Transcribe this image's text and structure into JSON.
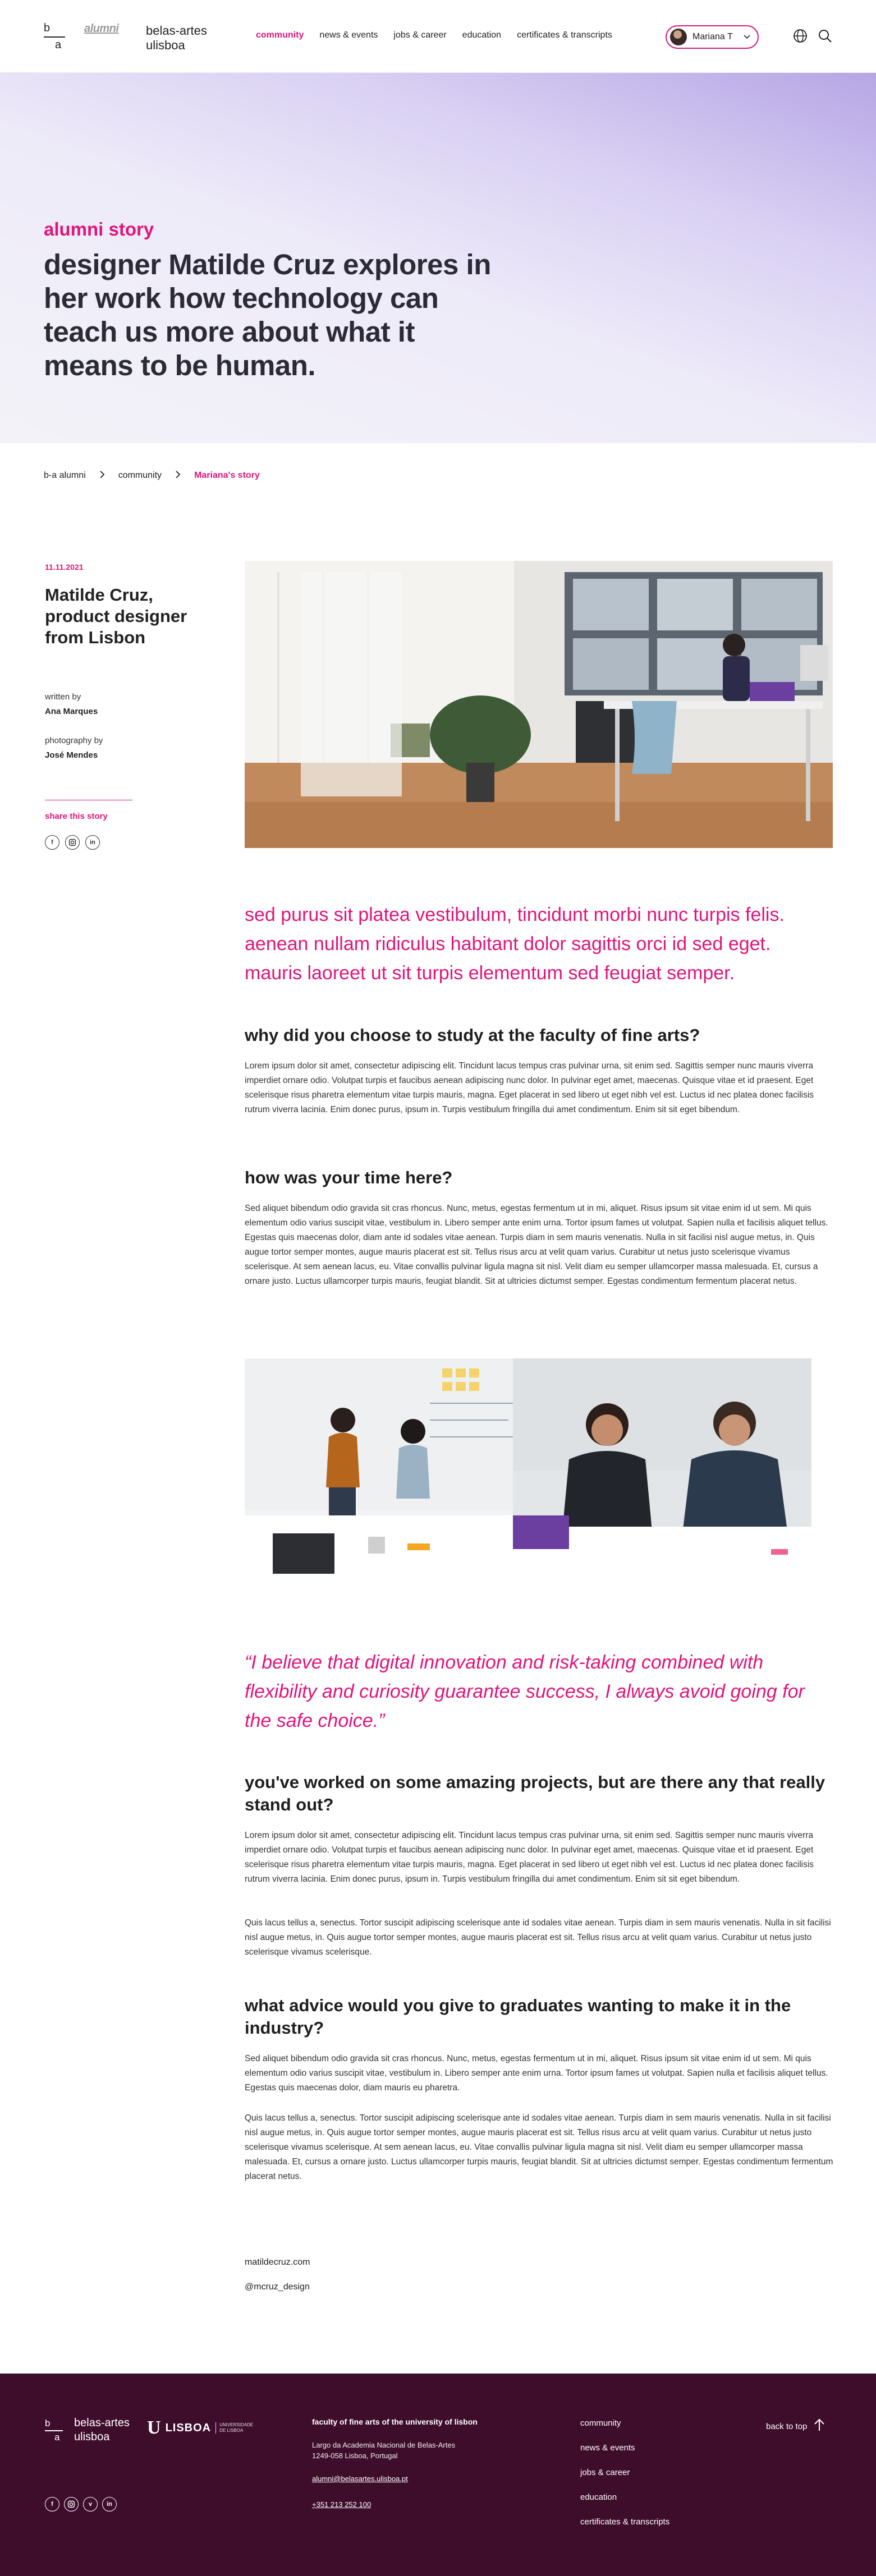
{
  "header": {
    "logo_b": "b",
    "logo_a": "a",
    "logo_alumni": "alumni",
    "org_name": "belas-artes ulisboa",
    "nav": [
      {
        "label": "community",
        "active": true
      },
      {
        "label": "news & events",
        "active": false
      },
      {
        "label": "jobs & career",
        "active": false
      },
      {
        "label": "education",
        "active": false
      },
      {
        "label": "certificates & transcripts",
        "active": false
      }
    ],
    "user_name": "Mariana T",
    "icons": {
      "avatar": "user-avatar",
      "chevron": "chevron-down-icon",
      "language": "globe-icon",
      "search": "search-icon"
    }
  },
  "hero": {
    "kicker": "alumni story",
    "title": "designer Matilde Cruz explores in her work how technology can teach us more about what it means to be human."
  },
  "breadcrumb": [
    {
      "label": "b-a alumni"
    },
    {
      "label": "community"
    },
    {
      "label": "Mariana's story"
    }
  ],
  "article": {
    "date": "11.11.2021",
    "subject": "Matilde Cruz, product designer from Lisbon",
    "written_by_label": "written by",
    "written_by": "Ana Marques",
    "photography_label": "photography by",
    "photography_by": "José Mendes",
    "share_label": "share this story",
    "share_icons": [
      "facebook-icon",
      "instagram-icon",
      "linkedin-icon"
    ],
    "lead": "sed purus sit platea vestibulum, tincidunt morbi nunc turpis felis. aenean nullam ridiculus habitant dolor sagittis orci id sed eget. mauris laoreet ut sit turpis elementum sed feugiat semper.",
    "sections": [
      {
        "heading": "why did you choose to study at the faculty of fine arts?",
        "paragraphs": [
          "Lorem ipsum dolor sit amet, consectetur adipiscing elit. Tincidunt lacus tempus cras pulvinar urna, sit enim sed. Sagittis semper nunc mauris viverra imperdiet ornare odio. Volutpat turpis et faucibus aenean adipiscing nunc dolor. In pulvinar eget amet, maecenas. Quisque vitae et id praesent. Eget scelerisque risus pharetra elementum vitae turpis mauris, magna. Eget placerat in sed libero ut eget nibh vel est. Luctus id nec platea donec facilisis rutrum viverra lacinia. Enim donec purus, ipsum in. Turpis vestibulum fringilla dui amet condimentum. Enim sit sit eget bibendum."
        ]
      },
      {
        "heading": "how was your time here?",
        "paragraphs": [
          "Sed aliquet bibendum odio gravida sit cras rhoncus. Nunc, metus, egestas fermentum ut in mi, aliquet. Risus ipsum sit vitae enim id ut sem. Mi quis elementum odio varius suscipit vitae, vestibulum in. Libero semper ante enim urna. Tortor ipsum fames ut volutpat. Sapien nulla et facilisis aliquet tellus. Egestas quis maecenas dolor, diam  ante id sodales vitae aenean. Turpis diam in sem mauris venenatis. Nulla in sit facilisi nisl augue metus, in. Quis augue tortor semper montes, augue mauris placerat est sit. Tellus risus arcu at velit quam varius. Curabitur ut netus justo scelerisque vivamus scelerisque. At sem aenean lacus, eu. Vitae convallis pulvinar ligula magna sit nisl. Velit diam eu semper ullamcorper massa malesuada. Et, cursus a ornare justo. Luctus ullamcorper turpis mauris, feugiat blandit. Sit at ultricies dictumst semper. Egestas condimentum fermentum placerat netus."
        ]
      },
      {
        "heading": "you've worked on some amazing projects, but are there any that really stand out?",
        "paragraphs": [
          "Lorem ipsum dolor sit amet, consectetur adipiscing elit. Tincidunt lacus tempus cras pulvinar urna, sit enim sed. Sagittis semper nunc mauris viverra imperdiet ornare odio. Volutpat turpis et faucibus aenean adipiscing nunc dolor. In pulvinar eget amet, maecenas. Quisque vitae et id praesent. Eget scelerisque risus pharetra elementum vitae turpis mauris, magna. Eget placerat in sed libero ut eget nibh vel est. Luctus id nec platea donec facilisis rutrum viverra lacinia. Enim donec purus, ipsum in. Turpis vestibulum fringilla dui amet condimentum. Enim sit sit eget bibendum.",
          "Quis lacus tellus a, senectus. Tortor suscipit adipiscing scelerisque ante id sodales vitae aenean. Turpis diam in sem mauris venenatis. Nulla in sit facilisi nisl augue metus, in. Quis augue tortor semper montes, augue mauris placerat est sit. Tellus risus arcu at velit quam varius. Curabitur ut netus justo scelerisque vivamus scelerisque."
        ]
      },
      {
        "heading": "what advice would you give to graduates wanting to make it in the industry?",
        "paragraphs": [
          "Sed aliquet bibendum odio gravida sit cras rhoncus. Nunc, metus, egestas fermentum ut in mi, aliquet. Risus ipsum sit vitae enim id ut sem. Mi quis elementum odio varius suscipit vitae, vestibulum in. Libero semper ante enim urna. Tortor ipsum fames ut volutpat. Sapien nulla et facilisis aliquet tellus. Egestas quis maecenas dolor, diam mauris eu pharetra.",
          "Quis lacus tellus a, senectus. Tortor suscipit adipiscing scelerisque ante id sodales vitae aenean. Turpis diam in sem mauris venenatis. Nulla in sit facilisi nisl augue metus, in. Quis augue tortor semper montes, augue mauris placerat est sit. Tellus risus arcu at velit quam varius. Curabitur ut netus justo scelerisque vivamus scelerisque. At sem aenean lacus, eu. Vitae convallis pulvinar ligula magna sit nisl. Velit diam eu semper ullamcorper massa malesuada. Et, cursus a ornare justo. Luctus ullamcorper turpis mauris, feugiat blandit. Sit at ultricies dictumst semper. Egestas condimentum fermentum placerat netus."
        ]
      }
    ],
    "quote": "“I believe that digital innovation and risk-taking combined with flexibility and curiosity guarantee success, I always avoid going for the safe choice.”",
    "website": "matildecruz.com",
    "handle": "@mcruz_design"
  },
  "footer": {
    "logo_b": "b",
    "logo_a": "a",
    "org_name": "belas-artes ulisboa",
    "ulisboa_mark": "U",
    "ulisboa_word": "LISBOA",
    "ulisboa_tagline": "UNIVERSIDADE DE LISBOA",
    "heading": "faculty of fine arts of the university of lisbon",
    "address_line1": "Largo da Academia Nacional de Belas-Artes",
    "address_line2": "1249-058 Lisboa, Portugal",
    "email": "alumni@belasartes.ulisboa.pt",
    "phone": "+351 213 252 100",
    "nav": [
      "community",
      "news & events",
      "jobs & career",
      "education",
      "certificates & transcripts"
    ],
    "back_to_top": "back to top",
    "social_icons": [
      "facebook-icon",
      "instagram-icon",
      "vimeo-icon",
      "linkedin-icon"
    ]
  },
  "colors": {
    "accent": "#e0157a",
    "footer_bg": "#3f0d2c",
    "hero_gradient_from": "#b6a6e5",
    "hero_gradient_to": "#f3f2f8"
  }
}
